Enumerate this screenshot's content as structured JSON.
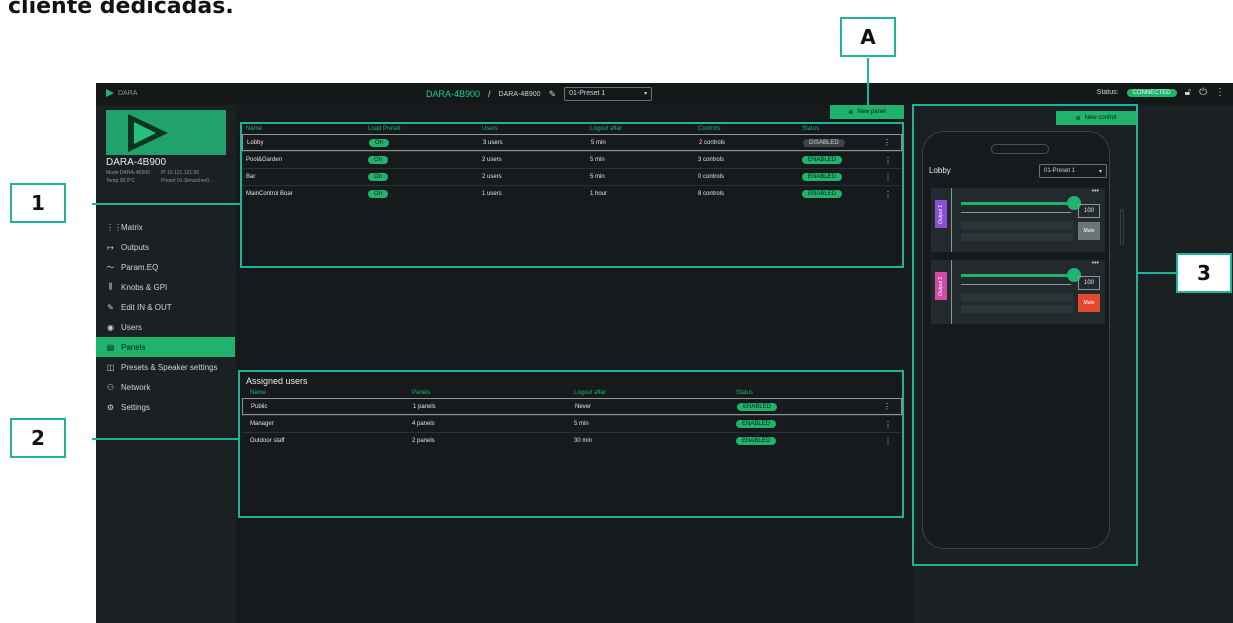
{
  "doc": {
    "heading": "cliente dedicadas."
  },
  "topbar": {
    "brand": "DARA",
    "device": "DARA-4B900",
    "sep": "/",
    "device2": "DARA-4B900",
    "preset": "01-Preset 1",
    "status_label": "Status:",
    "status_value": "CONNECTED"
  },
  "device": {
    "name": "DARA-4B900",
    "model_label": "Mode",
    "model": "DARA-4B900",
    "temp_label": "Temp",
    "temp": "38.0°C",
    "ip_label": "IP",
    "ip": "10.121.121.56",
    "preset_label": "Preset",
    "preset": "01-Simulcher0..."
  },
  "nav": [
    {
      "label": "Matrix",
      "icon": "matrix-icon",
      "glyph": "⋮⋮"
    },
    {
      "label": "Outputs",
      "icon": "outputs-icon",
      "glyph": "↦"
    },
    {
      "label": "Param.EQ",
      "icon": "eq-icon",
      "glyph": "〜"
    },
    {
      "label": "Knobs & GPI",
      "icon": "knobs-icon",
      "glyph": "⫼"
    },
    {
      "label": "Edit IN & OUT",
      "icon": "edit-icon",
      "glyph": "✎"
    },
    {
      "label": "Users",
      "icon": "users-icon",
      "glyph": "◉"
    },
    {
      "label": "Panels",
      "icon": "panels-icon",
      "glyph": "▤"
    },
    {
      "label": "Presets & Speaker settings",
      "icon": "presets-icon",
      "glyph": "◫"
    },
    {
      "label": "Network",
      "icon": "network-icon",
      "glyph": "⚇"
    },
    {
      "label": "Settings",
      "icon": "settings-icon",
      "glyph": "⚙"
    }
  ],
  "nav_active": "Panels",
  "panels": {
    "new_panel": "New panel",
    "headers": [
      "Name",
      "Load Preset",
      "Users",
      "Logout after",
      "Controls",
      "Status"
    ],
    "rows": [
      {
        "name": "Lobby",
        "load": "On",
        "users": "3 users",
        "logout": "5 min",
        "controls": "2 controls",
        "status": "DISABLED"
      },
      {
        "name": "Pool&Garden",
        "load": "On",
        "users": "2 users",
        "logout": "5 min",
        "controls": "3 controls",
        "status": "ENABLED"
      },
      {
        "name": "Bar",
        "load": "On",
        "users": "2 users",
        "logout": "5 min",
        "controls": "0 controls",
        "status": "ENABLED"
      },
      {
        "name": "MainControl Boar",
        "load": "On",
        "users": "1 users",
        "logout": "1 hour",
        "controls": "8 controls",
        "status": "ENABLED"
      }
    ]
  },
  "assigned": {
    "title": "Assigned users",
    "headers": [
      "Name",
      "Panels",
      "Logout after",
      "Status"
    ],
    "rows": [
      {
        "name": "Public",
        "panels": "1 panels",
        "logout": "Never",
        "status": "ENABLED"
      },
      {
        "name": "Manager",
        "panels": "4 panels",
        "logout": "5 min",
        "status": "ENABLED"
      },
      {
        "name": "Outdoor staff",
        "panels": "2 panels",
        "logout": "30 min",
        "status": "ENABLED"
      }
    ]
  },
  "preview": {
    "new_control": "New control",
    "title": "Lobby",
    "preset": "01-Preset 1",
    "cards": [
      {
        "tag": "Output 1",
        "tag_color": "#8a4fd6",
        "value": "100",
        "mute": "Mute",
        "mute_color": "#6b7478",
        "level": 1.0
      },
      {
        "tag": "Output 2",
        "tag_color": "#d14aa4",
        "value": "100",
        "mute": "Mute",
        "mute_color": "#e2492f",
        "level": 1.0
      }
    ]
  },
  "annotations": [
    "A",
    "1",
    "2",
    "3"
  ],
  "colors": {
    "accent": "#1fb36e",
    "annotation": "#1fb39a"
  }
}
